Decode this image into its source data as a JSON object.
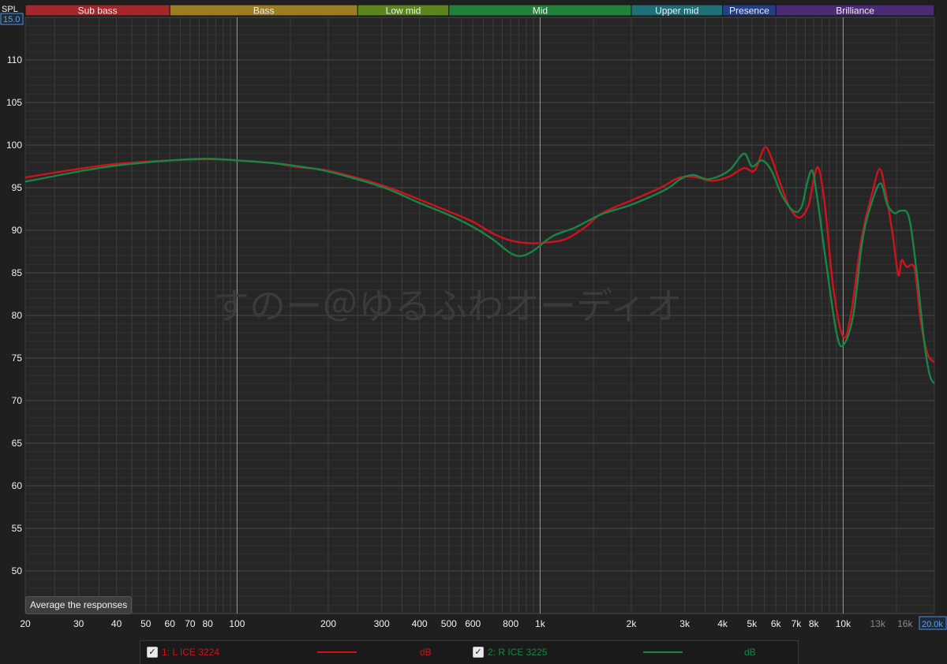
{
  "bands": [
    {
      "label": "Sub bass",
      "from": 20,
      "to": 60,
      "color": "#a3272b"
    },
    {
      "label": "Bass",
      "from": 60,
      "to": 250,
      "color": "#9c7d22"
    },
    {
      "label": "Low mid",
      "from": 250,
      "to": 500,
      "color": "#5c8520"
    },
    {
      "label": "Mid",
      "from": 500,
      "to": 2000,
      "color": "#22823c"
    },
    {
      "label": "Upper mid",
      "from": 2000,
      "to": 4000,
      "color": "#1e6f78"
    },
    {
      "label": "Presence",
      "from": 4000,
      "to": 6000,
      "color": "#243f86"
    },
    {
      "label": "Brilliance",
      "from": 6000,
      "to": 20000,
      "color": "#4b2a78"
    }
  ],
  "y_axis": {
    "unit_label": "SPL",
    "scale_box": "15.0"
  },
  "x_axis": {
    "end_box": "20.0k"
  },
  "watermark": "すのー＠ゆるふわオーディオ",
  "average_button": "Average the responses",
  "chart_data": {
    "type": "line",
    "xscale": "log",
    "xlim": [
      20,
      20000
    ],
    "ylim": [
      45,
      115
    ],
    "grid": true,
    "yticks": [
      50,
      55,
      60,
      65,
      70,
      75,
      80,
      85,
      90,
      95,
      100,
      105,
      110
    ],
    "xticks": [
      {
        "v": 20,
        "t": "20"
      },
      {
        "v": 30,
        "t": "30"
      },
      {
        "v": 40,
        "t": "40"
      },
      {
        "v": 50,
        "t": "50"
      },
      {
        "v": 60,
        "t": "60"
      },
      {
        "v": 70,
        "t": "70"
      },
      {
        "v": 80,
        "t": "80"
      },
      {
        "v": 100,
        "t": "100"
      },
      {
        "v": 200,
        "t": "200"
      },
      {
        "v": 300,
        "t": "300"
      },
      {
        "v": 400,
        "t": "400"
      },
      {
        "v": 500,
        "t": "500"
      },
      {
        "v": 600,
        "t": "600"
      },
      {
        "v": 800,
        "t": "800"
      },
      {
        "v": 1000,
        "t": "1k"
      },
      {
        "v": 2000,
        "t": "2k"
      },
      {
        "v": 3000,
        "t": "3k"
      },
      {
        "v": 4000,
        "t": "4k"
      },
      {
        "v": 5000,
        "t": "5k"
      },
      {
        "v": 6000,
        "t": "6k"
      },
      {
        "v": 7000,
        "t": "7k"
      },
      {
        "v": 8000,
        "t": "8k"
      },
      {
        "v": 10000,
        "t": "10k"
      },
      {
        "v": 13000,
        "t": "13k",
        "dim": true
      },
      {
        "v": 16000,
        "t": "16k",
        "dim": true
      }
    ],
    "series": [
      {
        "name": "1: L ICE 3224",
        "unit": "dB",
        "color": "#d0121c",
        "points": [
          [
            20,
            96.2
          ],
          [
            30,
            97.2
          ],
          [
            40,
            97.8
          ],
          [
            60,
            98.2
          ],
          [
            80,
            98.35
          ],
          [
            100,
            98.2
          ],
          [
            130,
            97.9
          ],
          [
            160,
            97.4
          ],
          [
            200,
            97.0
          ],
          [
            300,
            95.3
          ],
          [
            400,
            93.6
          ],
          [
            500,
            92.2
          ],
          [
            600,
            91.0
          ],
          [
            700,
            89.6
          ],
          [
            800,
            88.8
          ],
          [
            900,
            88.5
          ],
          [
            1000,
            88.5
          ],
          [
            1200,
            88.9
          ],
          [
            1400,
            90.3
          ],
          [
            1600,
            92.0
          ],
          [
            2000,
            93.5
          ],
          [
            2500,
            95.0
          ],
          [
            2800,
            96.0
          ],
          [
            3000,
            96.3
          ],
          [
            3300,
            96.2
          ],
          [
            3700,
            95.8
          ],
          [
            4200,
            96.3
          ],
          [
            4700,
            97.3
          ],
          [
            5100,
            97.0
          ],
          [
            5500,
            99.7
          ],
          [
            5800,
            98.5
          ],
          [
            6200,
            95.5
          ],
          [
            6700,
            92.5
          ],
          [
            7200,
            91.5
          ],
          [
            7700,
            93.0
          ],
          [
            8000,
            96.0
          ],
          [
            8300,
            97.3
          ],
          [
            8700,
            93.0
          ],
          [
            9300,
            83.0
          ],
          [
            10000,
            77.5
          ],
          [
            10600,
            80.0
          ],
          [
            11500,
            89.0
          ],
          [
            12500,
            94.5
          ],
          [
            13200,
            97.2
          ],
          [
            13800,
            94.5
          ],
          [
            14500,
            90.0
          ],
          [
            15200,
            84.8
          ],
          [
            15600,
            86.5
          ],
          [
            16200,
            85.7
          ],
          [
            17200,
            85.5
          ],
          [
            18000,
            79.5
          ],
          [
            19000,
            75.5
          ],
          [
            20000,
            74.5
          ]
        ]
      },
      {
        "name": "2: R ICE 3225",
        "unit": "dB",
        "color": "#188445",
        "points": [
          [
            20,
            95.7
          ],
          [
            30,
            96.9
          ],
          [
            40,
            97.6
          ],
          [
            60,
            98.2
          ],
          [
            80,
            98.4
          ],
          [
            100,
            98.2
          ],
          [
            130,
            97.9
          ],
          [
            160,
            97.5
          ],
          [
            200,
            96.9
          ],
          [
            300,
            95.1
          ],
          [
            400,
            93.2
          ],
          [
            500,
            91.8
          ],
          [
            600,
            90.4
          ],
          [
            700,
            88.9
          ],
          [
            800,
            87.3
          ],
          [
            870,
            87.0
          ],
          [
            950,
            87.6
          ],
          [
            1100,
            89.3
          ],
          [
            1300,
            90.3
          ],
          [
            1600,
            91.9
          ],
          [
            2000,
            93.0
          ],
          [
            2600,
            94.8
          ],
          [
            2900,
            96.0
          ],
          [
            3200,
            96.5
          ],
          [
            3600,
            96.0
          ],
          [
            4200,
            97.0
          ],
          [
            4700,
            99.0
          ],
          [
            5000,
            97.5
          ],
          [
            5400,
            98.2
          ],
          [
            5800,
            97.0
          ],
          [
            6300,
            94.0
          ],
          [
            6900,
            92.2
          ],
          [
            7300,
            92.8
          ],
          [
            7600,
            95.5
          ],
          [
            7900,
            97.0
          ],
          [
            8200,
            94.0
          ],
          [
            8800,
            86.0
          ],
          [
            9500,
            78.0
          ],
          [
            10000,
            76.5
          ],
          [
            10800,
            80.0
          ],
          [
            11600,
            89.0
          ],
          [
            12500,
            93.5
          ],
          [
            13300,
            95.5
          ],
          [
            14000,
            93.0
          ],
          [
            14800,
            92.0
          ],
          [
            15500,
            92.3
          ],
          [
            16500,
            91.5
          ],
          [
            17500,
            85.0
          ],
          [
            18500,
            77.0
          ],
          [
            19300,
            73.0
          ],
          [
            20000,
            72.0
          ]
        ]
      }
    ]
  }
}
